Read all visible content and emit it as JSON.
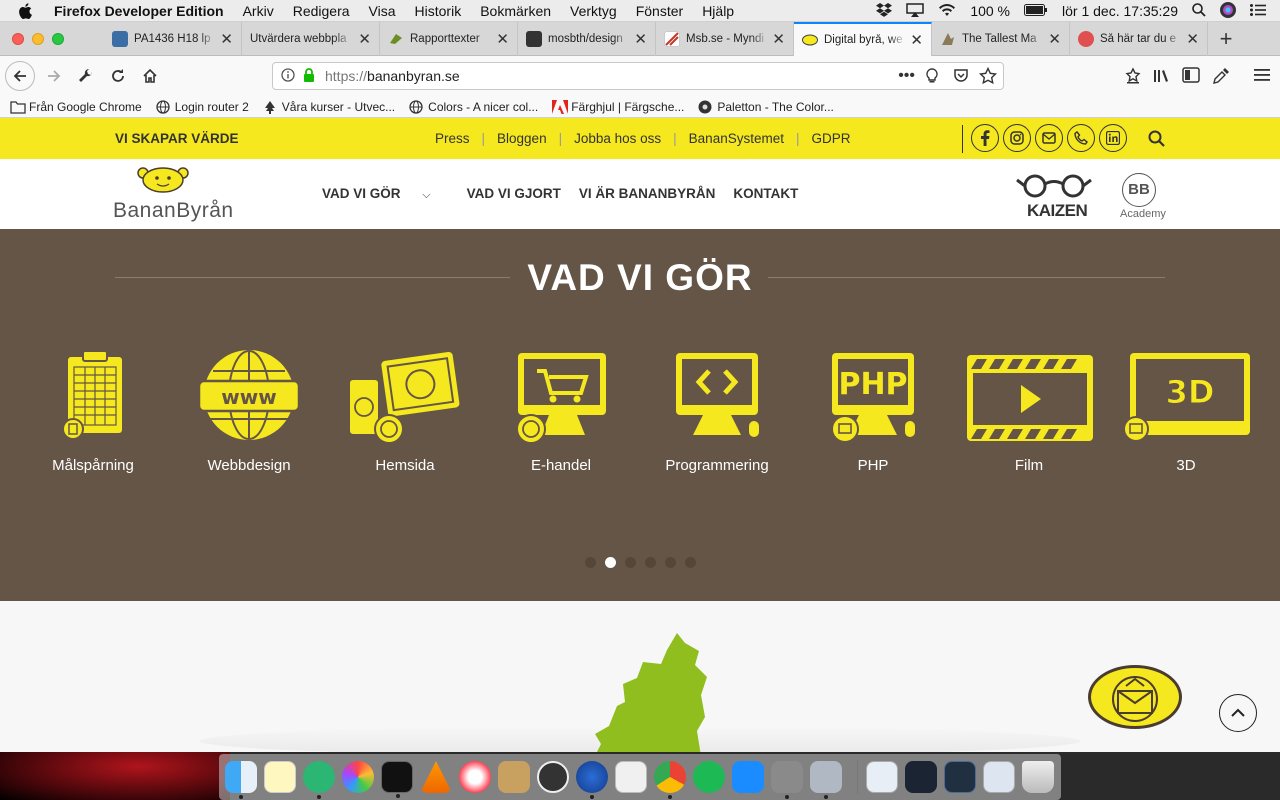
{
  "os_menubar": {
    "app_name": "Firefox Developer Edition",
    "menus": [
      "Arkiv",
      "Redigera",
      "Visa",
      "Historik",
      "Bokmärken",
      "Verktyg",
      "Fönster",
      "Hjälp"
    ],
    "battery": "100 %",
    "clock": "lör 1 dec.  17:35:29"
  },
  "tabs": [
    {
      "title": "PA1436 H18 lp",
      "favicon_color": "#3b6ea5"
    },
    {
      "title": "Utvärdera webbpla",
      "favicon_color": ""
    },
    {
      "title": "Rapporttexter",
      "favicon_color": "#6b8e23"
    },
    {
      "title": "mosbth/design",
      "favicon_color": "#333333"
    },
    {
      "title": "Msb.se - Myndi",
      "favicon_color": "#c0392b"
    },
    {
      "title": "Digital byrå, we",
      "favicon_color": "#f5e81f"
    },
    {
      "title": "The Tallest Ma",
      "favicon_color": "#8a7a5a"
    },
    {
      "title": "Så här tar du e",
      "favicon_color": "#e05050"
    }
  ],
  "active_tab_index": 5,
  "url": {
    "protocol": "https://",
    "host": "bananbyran.se"
  },
  "bookmarks": [
    {
      "label": "Från Google Chrome",
      "icon": "folder-icon"
    },
    {
      "label": "Login router 2",
      "icon": "globe-icon"
    },
    {
      "label": "Våra kurser - Utvec...",
      "icon": "tree-icon"
    },
    {
      "label": "Colors - A nicer col...",
      "icon": "globe-icon"
    },
    {
      "label": "Färghjul | Färgsche...",
      "icon": "adobe-icon"
    },
    {
      "label": "Paletton - The Color...",
      "icon": "paletton-icon"
    }
  ],
  "site": {
    "slogan": "VI SKAPAR VÄRDE",
    "top_links": [
      "Press",
      "Bloggen",
      "Jobba hos oss",
      "BananSystemet",
      "GDPR"
    ],
    "logo_text": "BananByrån",
    "nav": [
      "VAD VI GÖR",
      "VAD VI GJORT",
      "VI ÄR BANANBYRÅN",
      "KONTAKT"
    ],
    "partner_logos": [
      "KAIZEN",
      "BB",
      "Academy"
    ],
    "section_title": "VAD VI GÖR",
    "services": [
      "Målspårning",
      "Webbdesign",
      "Hemsida",
      "E-handel",
      "Programmering",
      "PHP",
      "Film",
      "3D"
    ],
    "carousel_dots": 6,
    "carousel_active": 1,
    "accent_yellow": "#f5e81f",
    "hero_brown": "#655546"
  }
}
